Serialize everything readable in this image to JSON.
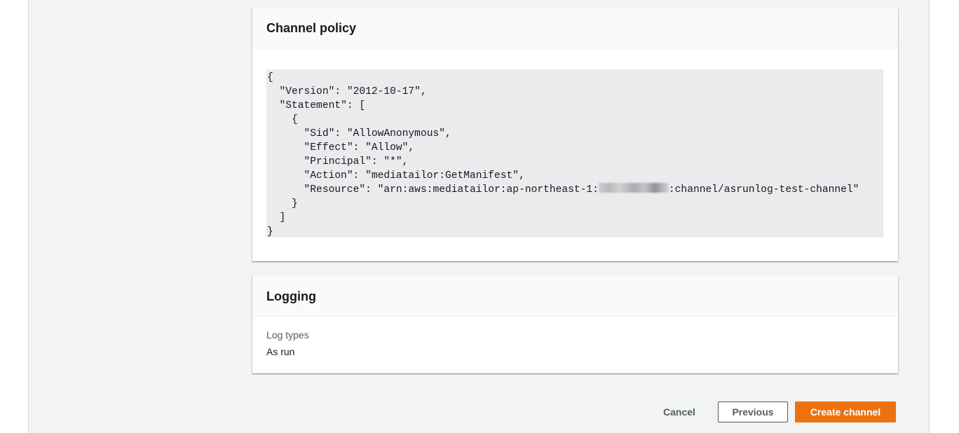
{
  "channel_policy": {
    "title": "Channel policy",
    "code_lines": [
      "{",
      "  \"Version\": \"2012-10-17\",",
      "  \"Statement\": [",
      "    {",
      "      \"Sid\": \"AllowAnonymous\",",
      "      \"Effect\": \"Allow\",",
      "      \"Principal\": \"*\",",
      "      \"Action\": \"mediatailor:GetManifest\","
    ],
    "resource_line_prefix": "      \"Resource\": \"arn:aws:mediatailor:ap-northeast-1:",
    "resource_line_suffix": ":channel/asrunlog-test-channel\"",
    "code_lines_end": [
      "    }",
      "  ]",
      "}"
    ]
  },
  "logging": {
    "title": "Logging",
    "log_types_label": "Log types",
    "log_types_value": "As run"
  },
  "actions": {
    "cancel_label": "Cancel",
    "previous_label": "Previous",
    "create_label": "Create channel"
  },
  "colors": {
    "primary_button": "#ec7211",
    "page_background": "#f2f3f3",
    "code_background": "#e9ebed"
  }
}
